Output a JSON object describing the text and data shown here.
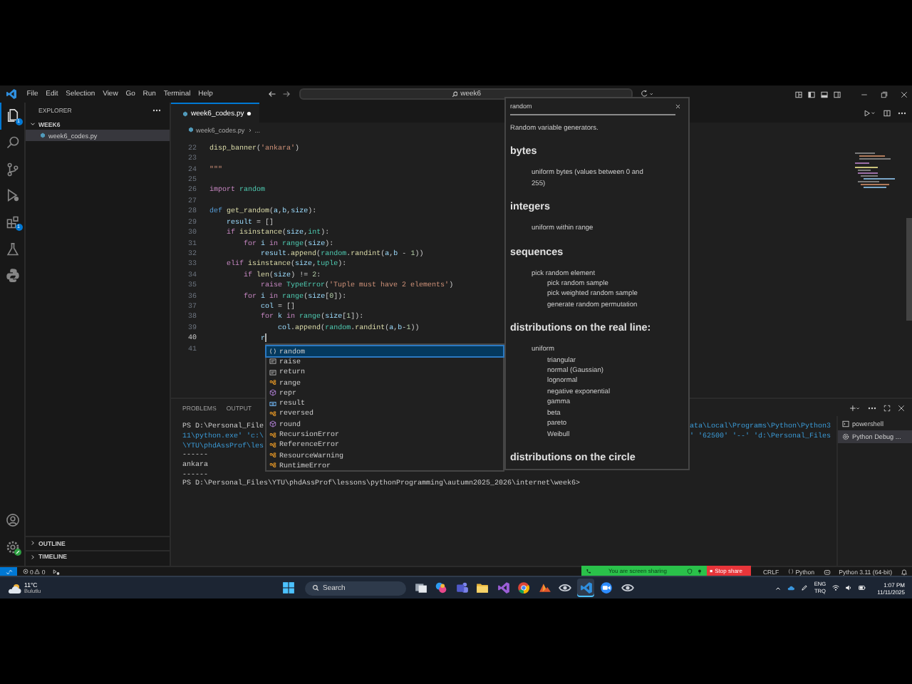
{
  "title_bar": {
    "menu": [
      "File",
      "Edit",
      "Selection",
      "View",
      "Go",
      "Run",
      "Terminal",
      "Help"
    ],
    "search": {
      "value": "week6"
    }
  },
  "activity_bar": {
    "items": [
      {
        "kind": "files",
        "selected": true,
        "badge": "1"
      },
      {
        "kind": "search",
        "selected": false
      },
      {
        "kind": "source_control",
        "selected": false
      },
      {
        "kind": "run_debug",
        "selected": false
      },
      {
        "kind": "extensions",
        "selected": false,
        "badge": "1"
      },
      {
        "kind": "testing",
        "selected": false
      },
      {
        "kind": "python",
        "selected": false
      }
    ],
    "bottom": [
      {
        "kind": "account"
      },
      {
        "kind": "manage"
      }
    ]
  },
  "sidebar": {
    "title": "EXPLORER",
    "folder": {
      "name": "WEEK6",
      "expanded": true,
      "children": [
        {
          "name": "week6_codes.py",
          "selected": true
        }
      ]
    },
    "sections": [
      {
        "name": "OUTLINE",
        "expanded": false
      },
      {
        "name": "TIMELINE",
        "expanded": false
      }
    ]
  },
  "editor": {
    "tabs": [
      {
        "label": "week6_codes.py",
        "selected": true,
        "modified": true
      }
    ],
    "breadcrumb": [
      "week6_codes.py",
      "..."
    ],
    "lines": [
      {
        "number": "22",
        "tokens": [
          {
            "text": "disp_banner",
            "kind": "function"
          },
          {
            "text": "(",
            "kind": "plain"
          },
          {
            "text": "'ankara'",
            "kind": "string"
          },
          {
            "text": ")",
            "kind": "plain"
          }
        ]
      },
      {
        "number": "23"
      },
      {
        "number": "24",
        "tokens": [
          {
            "text": "\"\"\"",
            "kind": "string"
          }
        ]
      },
      {
        "number": "25"
      },
      {
        "number": "26",
        "tokens": [
          {
            "text": "import ",
            "kind": "control"
          },
          {
            "text": "random",
            "kind": "module"
          }
        ]
      },
      {
        "number": "27"
      },
      {
        "number": "28",
        "tokens": [
          {
            "text": "def ",
            "kind": "keyword"
          },
          {
            "text": "get_random",
            "kind": "function"
          },
          {
            "text": "(",
            "kind": "plain"
          },
          {
            "text": "a",
            "kind": "variable"
          },
          {
            "text": ",",
            "kind": "plain"
          },
          {
            "text": "b",
            "kind": "variable"
          },
          {
            "text": ",",
            "kind": "plain"
          },
          {
            "text": "size",
            "kind": "variable"
          },
          {
            "text": "):",
            "kind": "plain"
          }
        ]
      },
      {
        "number": "29",
        "tokens": [
          {
            "text": "    result",
            "kind": "variable"
          },
          {
            "text": " = []",
            "kind": "plain"
          }
        ]
      },
      {
        "number": "30",
        "tokens": [
          {
            "text": "    if ",
            "kind": "control"
          },
          {
            "text": "isinstance",
            "kind": "function"
          },
          {
            "text": "(",
            "kind": "plain"
          },
          {
            "text": "size",
            "kind": "variable"
          },
          {
            "text": ",",
            "kind": "plain"
          },
          {
            "text": "int",
            "kind": "module"
          },
          {
            "text": "):",
            "kind": "plain"
          }
        ]
      },
      {
        "number": "31",
        "tokens": [
          {
            "text": "        for ",
            "kind": "control"
          },
          {
            "text": "i ",
            "kind": "variable"
          },
          {
            "text": "in ",
            "kind": "control"
          },
          {
            "text": "range",
            "kind": "module"
          },
          {
            "text": "(",
            "kind": "plain"
          },
          {
            "text": "size",
            "kind": "variable"
          },
          {
            "text": "):",
            "kind": "plain"
          }
        ]
      },
      {
        "number": "32",
        "tokens": [
          {
            "text": "            result",
            "kind": "variable"
          },
          {
            "text": ".",
            "kind": "plain"
          },
          {
            "text": "append",
            "kind": "function"
          },
          {
            "text": "(",
            "kind": "plain"
          },
          {
            "text": "random",
            "kind": "module"
          },
          {
            "text": ".",
            "kind": "plain"
          },
          {
            "text": "randint",
            "kind": "function"
          },
          {
            "text": "(",
            "kind": "plain"
          },
          {
            "text": "a",
            "kind": "variable"
          },
          {
            "text": ",",
            "kind": "plain"
          },
          {
            "text": "b",
            "kind": "variable"
          },
          {
            "text": " - ",
            "kind": "plain"
          },
          {
            "text": "1",
            "kind": "number"
          },
          {
            "text": "))",
            "kind": "plain"
          }
        ]
      },
      {
        "number": "33",
        "tokens": [
          {
            "text": "    elif ",
            "kind": "control"
          },
          {
            "text": "isinstance",
            "kind": "function"
          },
          {
            "text": "(",
            "kind": "plain"
          },
          {
            "text": "size",
            "kind": "variable"
          },
          {
            "text": ",",
            "kind": "plain"
          },
          {
            "text": "tuple",
            "kind": "module"
          },
          {
            "text": "):",
            "kind": "plain"
          }
        ]
      },
      {
        "number": "34",
        "tokens": [
          {
            "text": "        if ",
            "kind": "control"
          },
          {
            "text": "len",
            "kind": "function"
          },
          {
            "text": "(",
            "kind": "plain"
          },
          {
            "text": "size",
            "kind": "variable"
          },
          {
            "text": ") != ",
            "kind": "plain"
          },
          {
            "text": "2",
            "kind": "number"
          },
          {
            "text": ":",
            "kind": "plain"
          }
        ]
      },
      {
        "number": "35",
        "tokens": [
          {
            "text": "            raise ",
            "kind": "control"
          },
          {
            "text": "TypeError",
            "kind": "module"
          },
          {
            "text": "(",
            "kind": "plain"
          },
          {
            "text": "'Tuple must have 2 elements'",
            "kind": "string"
          },
          {
            "text": ")",
            "kind": "plain"
          }
        ]
      },
      {
        "number": "36",
        "tokens": [
          {
            "text": "        for ",
            "kind": "control"
          },
          {
            "text": "i ",
            "kind": "variable"
          },
          {
            "text": "in ",
            "kind": "control"
          },
          {
            "text": "range",
            "kind": "module"
          },
          {
            "text": "(",
            "kind": "plain"
          },
          {
            "text": "size",
            "kind": "variable"
          },
          {
            "text": "[",
            "kind": "plain"
          },
          {
            "text": "0",
            "kind": "number"
          },
          {
            "text": "]):",
            "kind": "plain"
          }
        ]
      },
      {
        "number": "37",
        "tokens": [
          {
            "text": "            col",
            "kind": "variable"
          },
          {
            "text": " = []",
            "kind": "plain"
          }
        ]
      },
      {
        "number": "38",
        "tokens": [
          {
            "text": "            for ",
            "kind": "control"
          },
          {
            "text": "k ",
            "kind": "variable"
          },
          {
            "text": "in ",
            "kind": "control"
          },
          {
            "text": "range",
            "kind": "module"
          },
          {
            "text": "(",
            "kind": "plain"
          },
          {
            "text": "size",
            "kind": "variable"
          },
          {
            "text": "[",
            "kind": "plain"
          },
          {
            "text": "1",
            "kind": "number"
          },
          {
            "text": "]):",
            "kind": "plain"
          }
        ]
      },
      {
        "number": "39",
        "tokens": [
          {
            "text": "                col",
            "kind": "variable"
          },
          {
            "text": ".",
            "kind": "plain"
          },
          {
            "text": "append",
            "kind": "function"
          },
          {
            "text": "(",
            "kind": "plain"
          },
          {
            "text": "random",
            "kind": "module"
          },
          {
            "text": ".",
            "kind": "plain"
          },
          {
            "text": "randint",
            "kind": "function"
          },
          {
            "text": "(",
            "kind": "plain"
          },
          {
            "text": "a",
            "kind": "variable"
          },
          {
            "text": ",",
            "kind": "plain"
          },
          {
            "text": "b",
            "kind": "variable"
          },
          {
            "text": "-",
            "kind": "plain"
          },
          {
            "text": "1",
            "kind": "number"
          },
          {
            "text": "))",
            "kind": "plain"
          }
        ]
      },
      {
        "number": "40",
        "cursor": true,
        "tokens": [
          {
            "text": "            r",
            "kind": "variable"
          }
        ]
      },
      {
        "number": "41"
      }
    ]
  },
  "completions": [
    {
      "label": "random",
      "kind": "module",
      "selected": true
    },
    {
      "label": "raise",
      "kind": "keyword",
      "selected": false
    },
    {
      "label": "return",
      "kind": "keyword",
      "selected": false
    },
    {
      "label": "range",
      "kind": "class",
      "selected": false
    },
    {
      "label": "repr",
      "kind": "function",
      "selected": false
    },
    {
      "label": "result",
      "kind": "variable",
      "selected": false
    },
    {
      "label": "reversed",
      "kind": "class",
      "selected": false
    },
    {
      "label": "round",
      "kind": "function",
      "selected": false
    },
    {
      "label": "RecursionError",
      "kind": "class",
      "selected": false
    },
    {
      "label": "ReferenceError",
      "kind": "class",
      "selected": false
    },
    {
      "label": "ResourceWarning",
      "kind": "class",
      "selected": false
    },
    {
      "label": "RuntimeError",
      "kind": "class",
      "selected": false
    }
  ],
  "hover": {
    "title": "random",
    "summary": "Random variable generators.",
    "sections": [
      {
        "heading": "bytes",
        "items": [
          {
            "text": "uniform bytes (values between 0 and 255)"
          }
        ]
      },
      {
        "heading": "integers",
        "items": [
          {
            "text": "uniform within range"
          }
        ]
      },
      {
        "heading": "sequences",
        "items": [
          {
            "text": "pick random element",
            "children": [
              {
                "text": "pick random sample"
              },
              {
                "text": "pick weighted random sample"
              },
              {
                "text": "generate random permutation"
              }
            ]
          }
        ]
      },
      {
        "heading": "distributions on the real line:",
        "items": [
          {
            "text": "uniform",
            "children": [
              {
                "text": "triangular"
              },
              {
                "text": "normal (Gaussian)"
              },
              {
                "text": "lognormal"
              },
              {
                "text": "negative exponential"
              },
              {
                "text": "gamma"
              },
              {
                "text": "beta"
              },
              {
                "text": "pareto"
              },
              {
                "text": "Weibull"
              }
            ]
          }
        ]
      },
      {
        "heading": "distributions on the circle"
      }
    ]
  },
  "panel": {
    "tabs": [
      "PROBLEMS",
      "OUTPUT"
    ],
    "terminal": [
      {
        "kind": "prompt",
        "text": "PS D:\\Personal_File",
        "tail": "ata\\Local\\Programs\\Python\\Python3"
      },
      {
        "kind": "command",
        "text": "11\\python.exe' 'c:\\",
        "tail": "' '62500' '--' 'd:\\Personal_Files"
      },
      {
        "kind": "command",
        "text": "\\YTU\\phdAssProf\\les"
      },
      {
        "kind": "output",
        "text": "------"
      },
      {
        "kind": "output",
        "text": "ankara"
      },
      {
        "kind": "output",
        "text": "------"
      },
      {
        "kind": "prompt",
        "text": "PS D:\\Personal_Files\\YTU\\phdAssProf\\lessons\\pythonProgramming\\autumn2025_2026\\internet\\week6>"
      }
    ],
    "terminals": [
      {
        "label": "powershell",
        "kind": "shell",
        "selected": false
      },
      {
        "label": "Python Debug ...",
        "kind": "debug",
        "selected": true
      }
    ]
  },
  "status_bar": {
    "errors": "0",
    "warnings": "0",
    "eol": "CRLF",
    "language": "Python",
    "interpreter": "Python 3.11 (64-bit)"
  },
  "screen_share": {
    "message": "You are screen sharing",
    "stop": "Stop share"
  },
  "taskbar": {
    "weather": {
      "temp": "11°C",
      "condition": "Bulutlu"
    },
    "search": "Search",
    "apps": [
      {
        "kind": "task_view",
        "selected": false
      },
      {
        "kind": "copilot",
        "selected": false
      },
      {
        "kind": "teams",
        "selected": false
      },
      {
        "kind": "explorer",
        "selected": false
      },
      {
        "kind": "visual_studio",
        "selected": false
      },
      {
        "kind": "chrome",
        "selected": false
      },
      {
        "kind": "peak",
        "selected": false
      },
      {
        "kind": "eye",
        "selected": false
      },
      {
        "kind": "vscode",
        "selected": true
      },
      {
        "kind": "zoom",
        "selected": false
      },
      {
        "kind": "eye",
        "selected": false
      }
    ],
    "language": [
      "ENG",
      "TRQ"
    ],
    "time": "1:07 PM",
    "date": "11/11/2025"
  }
}
